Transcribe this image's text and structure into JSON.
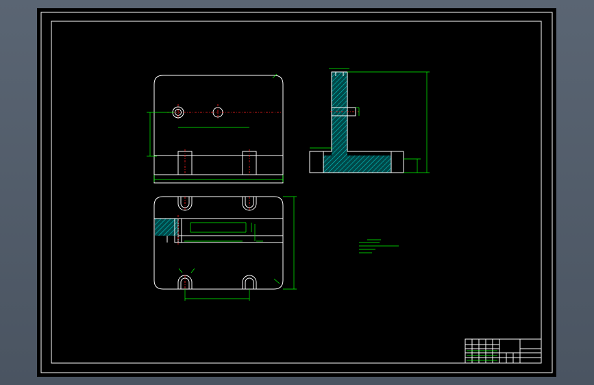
{
  "colors": {
    "background": "#000000",
    "outer_frame": "#4a5461",
    "geometry": "#ffffff",
    "dimension": "#00ff00",
    "centerline": "#ff2020",
    "hatch": "#00b0b0"
  },
  "icons": {
    "drawing-canvas": "cad-drawing"
  }
}
